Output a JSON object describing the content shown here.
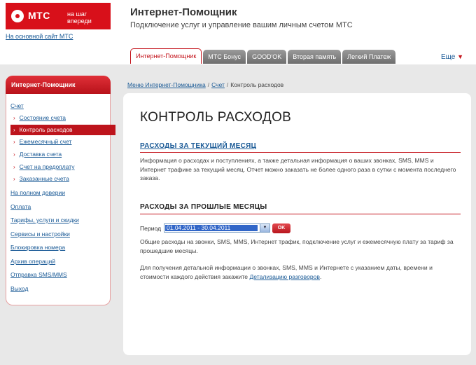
{
  "header": {
    "logo_name": "МТС",
    "logo_slogan": "на шаг впереди",
    "main_site_link": "На основной сайт МТС",
    "app_title": "Интернет-Помощник",
    "app_subtitle": "Подключение услуг и управление вашим личным счетом МТС"
  },
  "tabs": [
    {
      "label": "Интернет-Помощник",
      "active": true
    },
    {
      "label": "МТС Бонус",
      "active": false
    },
    {
      "label": "GOOD'OK",
      "active": false
    },
    {
      "label": "Вторая память",
      "active": false
    },
    {
      "label": "Легкий Платеж",
      "active": false
    }
  ],
  "tabs_more": "Еще",
  "sidebar": {
    "title": "Интернет-Помощник",
    "account_label": "Счет",
    "account_items": [
      "Состояние счета",
      "Контроль расходов",
      "Ежемесячный счет",
      "Доставка счета",
      "Счет на предоплату",
      "Заказанные счета"
    ],
    "active_item": "Контроль расходов",
    "sections": [
      "На полном доверии",
      "Оплата",
      "Тарифы, услуги и скидки",
      "Сервисы и настройки",
      "Блокировка номера",
      "Архив операций",
      "Отправка SMS/MMS",
      "Выход"
    ]
  },
  "breadcrumb": {
    "menu": "Меню Интернет-Помощника",
    "separator": "/",
    "account": "Счет",
    "current": "Контроль расходов"
  },
  "content": {
    "page_title": "КОНТРОЛЬ РАСХОДОВ",
    "current_month_link": "РАСХОДЫ ЗА ТЕКУЩИЙ МЕСЯЦ",
    "current_month_text": "Информация о расходах и поступлениях, а также детальная информация о ваших звонках, SMS, MMS и Интернет трафике за текущий месяц. Отчет можно заказать не более одного раза в сутки с момента последнего заказа.",
    "past_months_title": "РАСХОДЫ ЗА ПРОШЛЫЕ МЕСЯЦЫ",
    "period_label": "Период",
    "period_value": "01.04.2011 - 30.04.2011",
    "ok_label": "OK",
    "past_months_text": "Общие расходы на звонки, SMS, MMS, Интернет трафик, подключение услуг и ежемесячную плату за тариф за прошедшие месяцы.",
    "details_text": "Для получения детальной информации о звонках, SMS, MMS и Интернете с указанием даты, времени и стоимости каждого действия закажите ",
    "details_link": "Детализацию разговоров",
    "details_end": "."
  },
  "colors": {
    "brand_red": "#d8101a",
    "link_blue": "#1a5a96",
    "band_grey": "#e8e8e8"
  }
}
